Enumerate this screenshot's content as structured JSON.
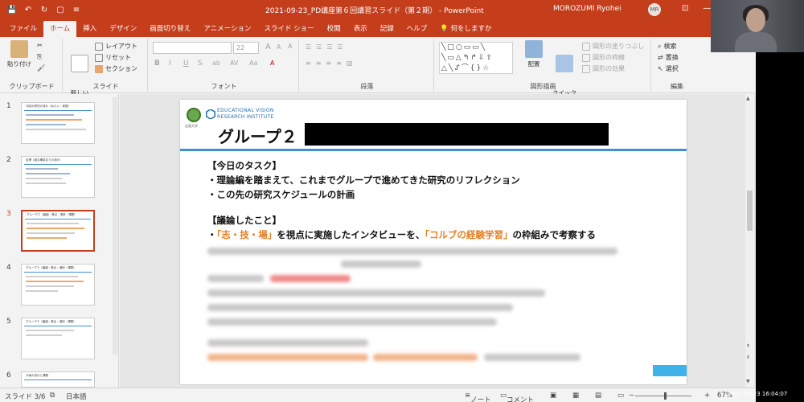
{
  "window": {
    "doc_title": "2021-09-23_PD講座第６回講習スライド（第２期） - PowerPoint",
    "user_name": "MOROZUMI Ryohei",
    "user_initials": "MR",
    "qat": {
      "save": "💾",
      "undo": "↶",
      "redo": "↻",
      "new": "▢",
      "more": "≡"
    },
    "controls": {
      "ribbon_display": "⊡",
      "minimize": "—"
    }
  },
  "tabs": [
    {
      "label": "ファイル"
    },
    {
      "label": "ホーム"
    },
    {
      "label": "挿入"
    },
    {
      "label": "デザイン"
    },
    {
      "label": "画面切り替え"
    },
    {
      "label": "アニメーション"
    },
    {
      "label": "スライド ショー"
    },
    {
      "label": "校閲"
    },
    {
      "label": "表示"
    },
    {
      "label": "記録"
    },
    {
      "label": "ヘルプ"
    },
    {
      "label": "何をしますか"
    }
  ],
  "tell_me_icon": "💡",
  "ribbon": {
    "clipboard": {
      "label": "クリップボード",
      "paste": "貼り付け",
      "cut": "✂",
      "copy": "⎘",
      "format_painter": "🖌"
    },
    "slides": {
      "label": "スライド",
      "new_slide": "新しい\nスライド",
      "layout": "レイアウト",
      "reset": "リセット",
      "section": "セクション"
    },
    "font": {
      "label": "フォント",
      "font_name": "",
      "font_size": "22",
      "bold": "B",
      "italic": "I",
      "underline": "U",
      "strike": "S",
      "shadow": "ab",
      "spacing": "AV",
      "case": "Aa",
      "grow": "A",
      "shrink": "A",
      "clear": "A",
      "color": "A"
    },
    "paragraph": {
      "label": "段落"
    },
    "drawing": {
      "label": "図形描画",
      "arrange": "配置",
      "quick_styles": "クイック\nスタイル",
      "fill": "図形の塗りつぶし",
      "outline": "図形の枠線",
      "effects": "図形の効果",
      "shapes_glyphs": "╲□○▭▭╲ ╲▭△↰↱⇩⇧ △╲ᔑ⌒{}☆"
    },
    "editing": {
      "label": "編集",
      "find": "検索",
      "replace": "置換",
      "select": "選択"
    }
  },
  "thumbnails": [
    {
      "num": "1",
      "title": "今回の研究の流れ（ねらい・実施）"
    },
    {
      "num": "2",
      "title": "目標（論文構成までの流れ）"
    },
    {
      "num": "3",
      "title": "グループ２（議論・焦点・進捗・課題）"
    },
    {
      "num": "4",
      "title": "グループ３（議論・焦点・進捗・課題）"
    },
    {
      "num": "5",
      "title": "グループ４（議論・焦点・進捗・課題）"
    },
    {
      "num": "6",
      "title": "今後の流れと課題"
    }
  ],
  "slide": {
    "logo_sub": "広島大学",
    "org_line1": "EDUCATIONAL VISION",
    "org_line2": "RESEARCH INSTITUTE",
    "title": "グループ２",
    "task_heading": "【今日のタスク】",
    "task_1": "・理論編を踏まえて、これまでグループで進めてきた研究のリフレクション",
    "task_2": "・この先の研究スケジュールの計画",
    "discussion_heading": "【議論したこと】",
    "d1_prefix": "・",
    "d1_hl1": "「志・技・場」",
    "d1_mid": "を視点に実施したインタビューを、",
    "d1_hl2": "「コルブの経験学習」",
    "d1_suffix": "の枠組みで考察する"
  },
  "status": {
    "slide_pos": "スライド 3/6",
    "language": "日本語",
    "notes": "ノート",
    "comments": "コメント",
    "zoom": "67%"
  },
  "os": {
    "clock": "2021-09-23  16:04:07"
  }
}
